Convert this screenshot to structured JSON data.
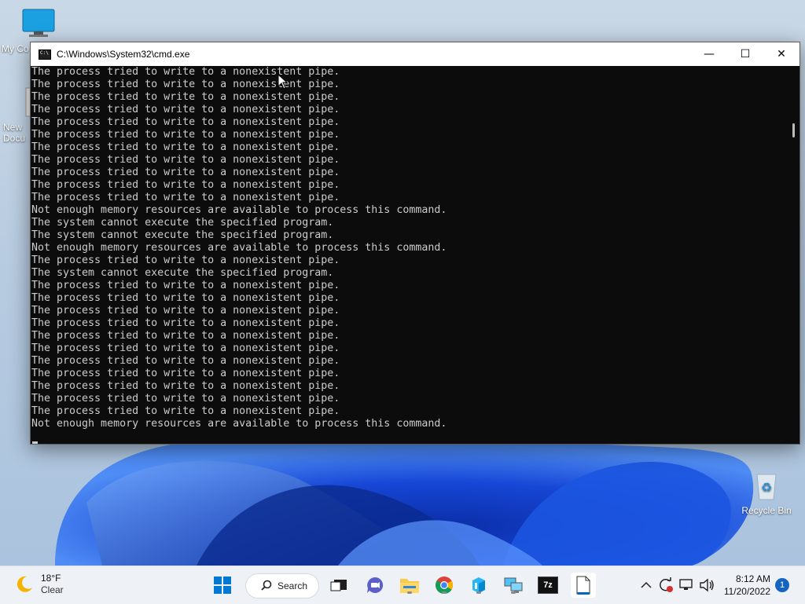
{
  "desktop": {
    "icons": [
      {
        "label": "My Co"
      },
      {
        "label": "New Docu"
      },
      {
        "label": "Recycle Bin"
      }
    ]
  },
  "window": {
    "title": "C:\\Windows\\System32\\cmd.exe",
    "minimize": "—",
    "maximize": "☐",
    "close": "✕",
    "console_text": "The process tried to write to a nonexistent pipe.\nThe process tried to write to a nonexistent pipe.\nThe process tried to write to a nonexistent pipe.\nThe process tried to write to a nonexistent pipe.\nThe process tried to write to a nonexistent pipe.\nThe process tried to write to a nonexistent pipe.\nThe process tried to write to a nonexistent pipe.\nThe process tried to write to a nonexistent pipe.\nThe process tried to write to a nonexistent pipe.\nThe process tried to write to a nonexistent pipe.\nThe process tried to write to a nonexistent pipe.\nNot enough memory resources are available to process this command.\nThe system cannot execute the specified program.\nThe system cannot execute the specified program.\nNot enough memory resources are available to process this command.\nThe process tried to write to a nonexistent pipe.\nThe system cannot execute the specified program.\nThe process tried to write to a nonexistent pipe.\nThe process tried to write to a nonexistent pipe.\nThe process tried to write to a nonexistent pipe.\nThe process tried to write to a nonexistent pipe.\nThe process tried to write to a nonexistent pipe.\nThe process tried to write to a nonexistent pipe.\nThe process tried to write to a nonexistent pipe.\nThe process tried to write to a nonexistent pipe.\nThe process tried to write to a nonexistent pipe.\nThe process tried to write to a nonexistent pipe.\nThe process tried to write to a nonexistent pipe.\nNot enough memory resources are available to process this command."
  },
  "taskbar": {
    "weather": {
      "temp": "18°F",
      "condition": "Clear",
      "icon": "moon-icon"
    },
    "search_label": "Search",
    "apps": [
      {
        "name": "start-button",
        "icon": "windows-logo-icon"
      },
      {
        "name": "task-view-button",
        "icon": "task-view-icon"
      },
      {
        "name": "teams-chat-button",
        "icon": "chat-icon"
      },
      {
        "name": "file-explorer-button",
        "icon": "folder-icon"
      },
      {
        "name": "chrome-button",
        "icon": "chrome-icon"
      },
      {
        "name": "app-cube-button",
        "icon": "cube-icon"
      },
      {
        "name": "network-app-button",
        "icon": "network-icon"
      },
      {
        "name": "7zip-button",
        "icon": "7zip-icon",
        "label": "7z"
      },
      {
        "name": "document-button",
        "icon": "document-icon"
      }
    ],
    "clock": {
      "time": "8:12 AM",
      "date": "11/20/2022"
    },
    "notifications": "1"
  },
  "colors": {
    "console_bg": "#0c0c0c",
    "console_fg": "#cccccc",
    "accent": "#0067c0"
  }
}
